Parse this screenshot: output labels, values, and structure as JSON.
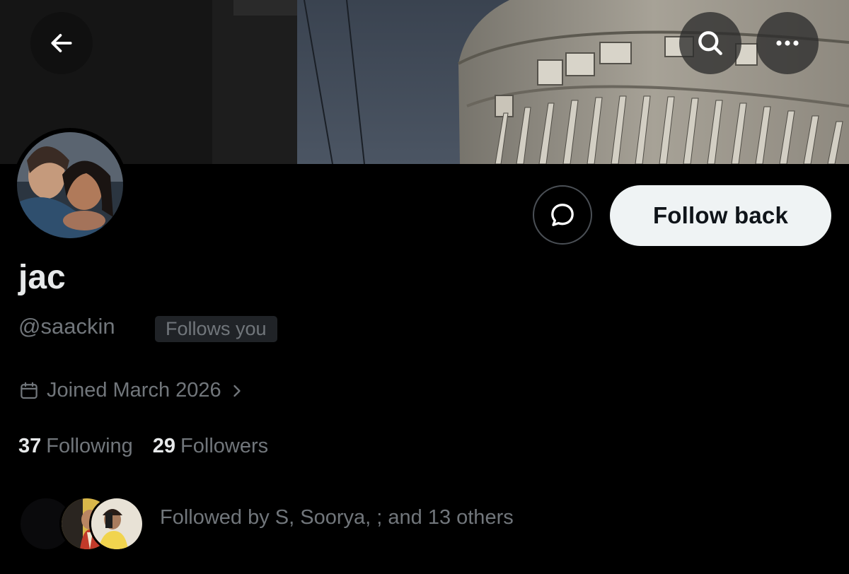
{
  "header": {
    "back_icon": "arrow-left-icon",
    "search_icon": "search-icon",
    "more_icon": "more-horizontal-icon"
  },
  "profile": {
    "display_name": "jac",
    "handle": "@saackin",
    "follows_you_badge": "Follows you",
    "joined": "Joined March 2026",
    "following_count": "37",
    "following_label": "Following",
    "followers_count": "29",
    "followers_label": "Followers",
    "followed_by": "Followed by S, Soorya, ; and 13 others"
  },
  "actions": {
    "message_icon": "message-bubble-icon",
    "follow_back_label": "Follow back"
  },
  "colors": {
    "background": "#000000",
    "primary_text": "#e7e9ea",
    "secondary_text": "#71767b",
    "badge_bg": "#202327",
    "button_bg": "#eff3f4",
    "button_text": "#0f1419"
  }
}
